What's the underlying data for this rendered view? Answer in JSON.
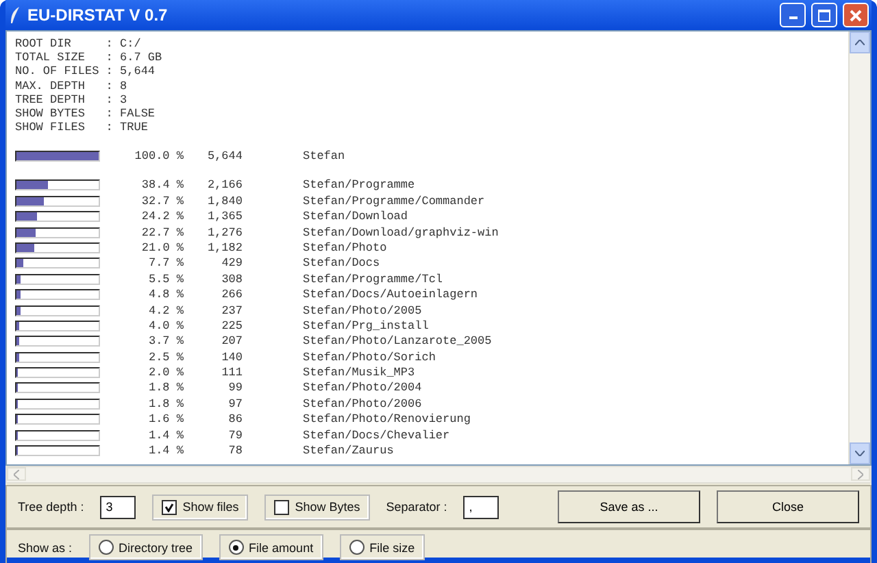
{
  "window": {
    "title": "EU-DIRSTAT V 0.7"
  },
  "summary": [
    "ROOT DIR     : C:/",
    "TOTAL SIZE   : 6.7 GB",
    "NO. OF FILES : 5,644",
    "MAX. DEPTH   : 8",
    "TREE DEPTH   : 3",
    "SHOW BYTES   : FALSE",
    "SHOW FILES   : TRUE"
  ],
  "total": {
    "level": 1.0,
    "percent": "100.0 %",
    "count": "5,644",
    "path": "Stefan"
  },
  "rows": [
    {
      "level": 0.384,
      "percent": "38.4 %",
      "count": "2,166",
      "path": "Stefan/Programme"
    },
    {
      "level": 0.327,
      "percent": "32.7 %",
      "count": "1,840",
      "path": "Stefan/Programme/Commander"
    },
    {
      "level": 0.242,
      "percent": "24.2 %",
      "count": "1,365",
      "path": "Stefan/Download"
    },
    {
      "level": 0.227,
      "percent": "22.7 %",
      "count": "1,276",
      "path": "Stefan/Download/graphviz-win"
    },
    {
      "level": 0.21,
      "percent": "21.0 %",
      "count": "1,182",
      "path": "Stefan/Photo"
    },
    {
      "level": 0.077,
      "percent": "7.7 %",
      "count": "429",
      "path": "Stefan/Docs"
    },
    {
      "level": 0.055,
      "percent": "5.5 %",
      "count": "308",
      "path": "Stefan/Programme/Tcl"
    },
    {
      "level": 0.048,
      "percent": "4.8 %",
      "count": "266",
      "path": "Stefan/Docs/Autoeinlagern"
    },
    {
      "level": 0.042,
      "percent": "4.2 %",
      "count": "237",
      "path": "Stefan/Photo/2005"
    },
    {
      "level": 0.04,
      "percent": "4.0 %",
      "count": "225",
      "path": "Stefan/Prg_install"
    },
    {
      "level": 0.037,
      "percent": "3.7 %",
      "count": "207",
      "path": "Stefan/Photo/Lanzarote_2005"
    },
    {
      "level": 0.025,
      "percent": "2.5 %",
      "count": "140",
      "path": "Stefan/Photo/Sorich"
    },
    {
      "level": 0.02,
      "percent": "2.0 %",
      "count": "111",
      "path": "Stefan/Musik_MP3"
    },
    {
      "level": 0.018,
      "percent": "1.8 %",
      "count": "99",
      "path": "Stefan/Photo/2004"
    },
    {
      "level": 0.018,
      "percent": "1.8 %",
      "count": "97",
      "path": "Stefan/Photo/2006"
    },
    {
      "level": 0.016,
      "percent": "1.6 %",
      "count": "86",
      "path": "Stefan/Photo/Renovierung"
    },
    {
      "level": 0.014,
      "percent": "1.4 %",
      "count": "79",
      "path": "Stefan/Docs/Chevalier"
    },
    {
      "level": 0.014,
      "percent": "1.4 %",
      "count": "78",
      "path": "Stefan/Zaurus"
    }
  ],
  "options": {
    "tree_depth": {
      "label": "Tree depth :",
      "value": "3"
    },
    "show_files": {
      "label": "Show files",
      "checked": true
    },
    "show_bytes": {
      "label": "Show Bytes",
      "checked": false
    },
    "separator": {
      "label": "Separator :",
      "value": ","
    },
    "buttons": [
      "Save as ...",
      "Close"
    ]
  },
  "show_as": {
    "label": "Show as :",
    "choices": [
      {
        "label": "Directory tree",
        "selected": false
      },
      {
        "label": "File amount",
        "selected": true
      },
      {
        "label": "File size",
        "selected": false
      }
    ]
  }
}
